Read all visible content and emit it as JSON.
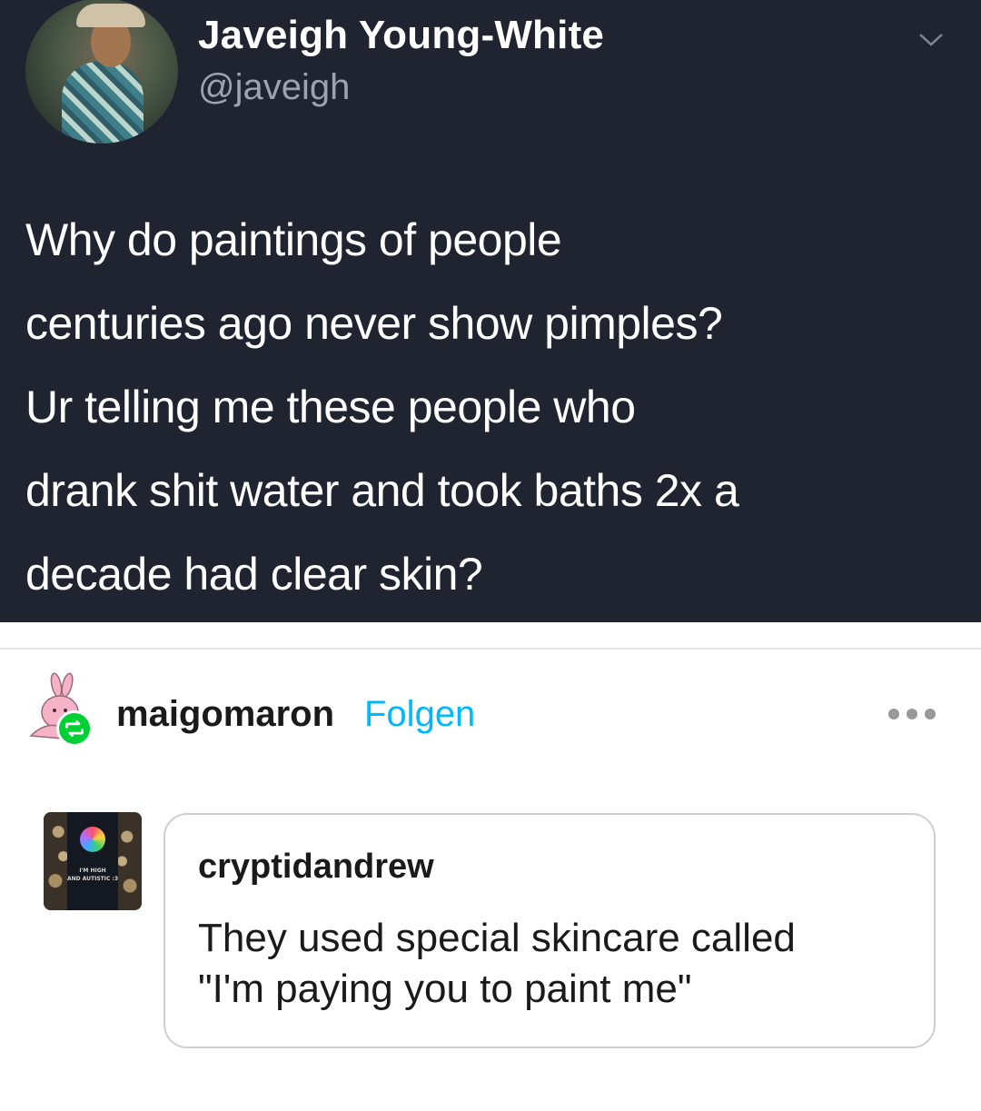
{
  "tweet": {
    "display_name": "Javeigh Young-White",
    "handle": "@javeigh",
    "text_lines": [
      "Why do paintings of people",
      "centuries ago never show pimples?",
      "Ur telling me these people who",
      "drank shit water and took baths 2x a",
      "decade had clear skin?"
    ],
    "background_color": "#1f2430"
  },
  "post": {
    "reblogger": "maigomaron",
    "follow_label": "Folgen",
    "accent_color": "#00b8ff",
    "reblog_badge_color": "#00cf35"
  },
  "comment": {
    "username": "cryptidandrew",
    "avatar_caption": [
      "I'M HIGH",
      "AND AUTISTIC :3"
    ],
    "text_lines": [
      "They used special skincare called",
      "\"I'm paying you to paint me\""
    ]
  }
}
